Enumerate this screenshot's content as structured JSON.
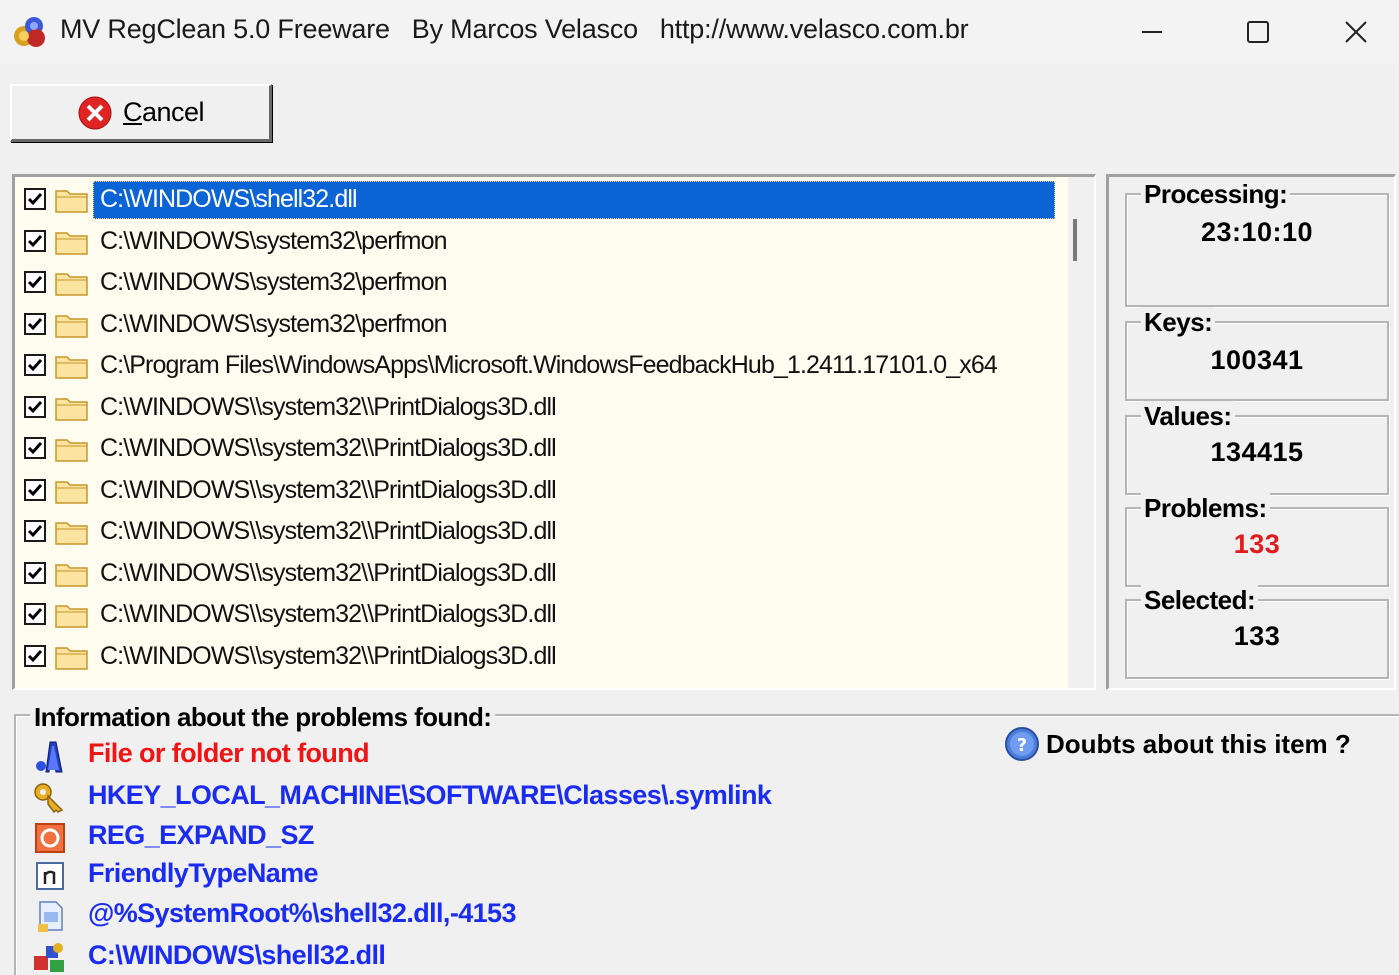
{
  "window": {
    "title": "MV RegClean 5.0 Freeware   By Marcos Velasco   http://www.velasco.com.br",
    "app_icon": "regclean-app-icon",
    "controls": [
      "minimize-icon",
      "maximize-icon",
      "close-icon"
    ]
  },
  "toolbar": {
    "cancel_label_prefix": "C",
    "cancel_label_rest": "ancel",
    "cancel_icon": "red-x-circle-icon"
  },
  "list": {
    "items": [
      {
        "checked": true,
        "path": "C:\\WINDOWS\\shell32.dll",
        "selected": true
      },
      {
        "checked": true,
        "path": "C:\\WINDOWS\\system32\\perfmon",
        "selected": false
      },
      {
        "checked": true,
        "path": "C:\\WINDOWS\\system32\\perfmon",
        "selected": false
      },
      {
        "checked": true,
        "path": "C:\\WINDOWS\\system32\\perfmon",
        "selected": false
      },
      {
        "checked": true,
        "path": "C:\\Program Files\\WindowsApps\\Microsoft.WindowsFeedbackHub_1.2411.17101.0_x64",
        "selected": false
      },
      {
        "checked": true,
        "path": "C:\\WINDOWS\\\\system32\\\\PrintDialogs3D.dll",
        "selected": false
      },
      {
        "checked": true,
        "path": "C:\\WINDOWS\\\\system32\\\\PrintDialogs3D.dll",
        "selected": false
      },
      {
        "checked": true,
        "path": "C:\\WINDOWS\\\\system32\\\\PrintDialogs3D.dll",
        "selected": false
      },
      {
        "checked": true,
        "path": "C:\\WINDOWS\\\\system32\\\\PrintDialogs3D.dll",
        "selected": false
      },
      {
        "checked": true,
        "path": "C:\\WINDOWS\\\\system32\\\\PrintDialogs3D.dll",
        "selected": false
      },
      {
        "checked": true,
        "path": "C:\\WINDOWS\\\\system32\\\\PrintDialogs3D.dll",
        "selected": false
      },
      {
        "checked": true,
        "path": "C:\\WINDOWS\\\\system32\\\\PrintDialogs3D.dll",
        "selected": false
      }
    ]
  },
  "stats": {
    "processing_label": "Processing:",
    "processing_value": "23:10:10",
    "keys_label": "Keys:",
    "keys_value": "100341",
    "values_label": "Values:",
    "values_value": "134415",
    "problems_label": "Problems:",
    "problems_value": "133",
    "selected_label": "Selected:",
    "selected_value": "133",
    "problems_color": "#e21c1c"
  },
  "info": {
    "title": "Information about the problems found:",
    "doubts_label": "Doubts about this item ?",
    "doubts_icon": "help-question-icon",
    "rows": [
      {
        "icon": "problem-type-icon",
        "text": "File or folder not found",
        "color": "#f01414"
      },
      {
        "icon": "registry-key-icon",
        "text": "HKEY_LOCAL_MACHINE\\SOFTWARE\\Classes\\.symlink",
        "color": "#1a2cf0"
      },
      {
        "icon": "value-type-icon",
        "text": "REG_EXPAND_SZ",
        "color": "#1a2cf0"
      },
      {
        "icon": "value-name-icon",
        "text": "FriendlyTypeName",
        "color": "#1a2cf0"
      },
      {
        "icon": "value-data-icon",
        "text": "@%SystemRoot%\\shell32.dll,-4153",
        "color": "#1a2cf0"
      },
      {
        "icon": "path-icon",
        "text": "C:\\WINDOWS\\shell32.dll",
        "color": "#1a2cf0"
      }
    ]
  }
}
